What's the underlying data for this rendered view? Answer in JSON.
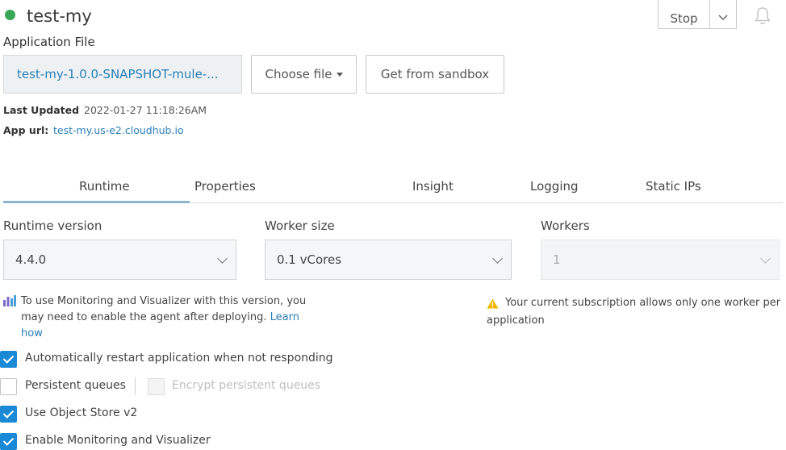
{
  "header": {
    "app_name": "test-my",
    "status_color": "#3aa757",
    "stop_label": "Stop",
    "dropdown_icon": "chevron-down-icon",
    "notification_icon": "bell-icon"
  },
  "application_file": {
    "label": "Application File",
    "file_name": "test-my-1.0.0-SNAPSHOT-mule-...",
    "choose_file_label": "Choose file",
    "sandbox_label": "Get from sandbox"
  },
  "meta": {
    "last_updated_label": "Last Updated",
    "last_updated_value": "2022-01-27 11:18:26AM",
    "app_url_label": "App url:",
    "app_url_value": "test-my.us-e2.cloudhub.io"
  },
  "tabs": [
    {
      "label": "Runtime",
      "active": true
    },
    {
      "label": "Properties",
      "active": false
    },
    {
      "label": "Insight",
      "active": false
    },
    {
      "label": "Logging",
      "active": false
    },
    {
      "label": "Static IPs",
      "active": false
    }
  ],
  "runtime": {
    "runtime_version_label": "Runtime version",
    "runtime_version_value": "4.4.0",
    "worker_size_label": "Worker size",
    "worker_size_value": "0.1 vCores",
    "workers_label": "Workers",
    "workers_value": "1",
    "monitoring_note": "To use Monitoring and Visualizer with this version, you may need to enable the agent after deploying.",
    "learn_how": "Learn how",
    "subscription_warning_line1": "Your current subscription allows only one worker per",
    "subscription_warning_line2": "application",
    "accent_color": "#1b8ad6",
    "warning_color": "#f0b400"
  },
  "options": [
    {
      "label": "Automatically restart application when not responding",
      "checked": true
    },
    {
      "label": "Persistent queues",
      "checked": false
    },
    {
      "label": "Encrypt persistent queues",
      "checked": false,
      "disabled": true
    },
    {
      "label": "Use Object Store v2",
      "checked": true
    },
    {
      "label": "Enable Monitoring and Visualizer",
      "checked": true
    }
  ]
}
